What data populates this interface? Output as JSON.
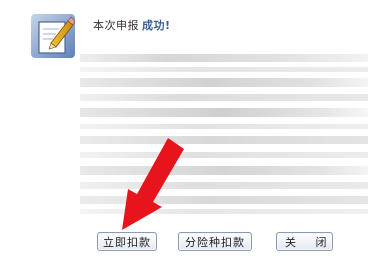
{
  "dialog": {
    "message_prefix": "本次申报",
    "message_status": "成功!",
    "status_color": "#3a5d9c",
    "icon": "notepad-pencil-icon"
  },
  "buttons": {
    "pay_now": "立即扣款",
    "pay_by_tax_type": "分险种扣款",
    "close": "关 闭"
  },
  "annotation": {
    "icon": "red-arrow-icon",
    "color": "#e8141b"
  }
}
